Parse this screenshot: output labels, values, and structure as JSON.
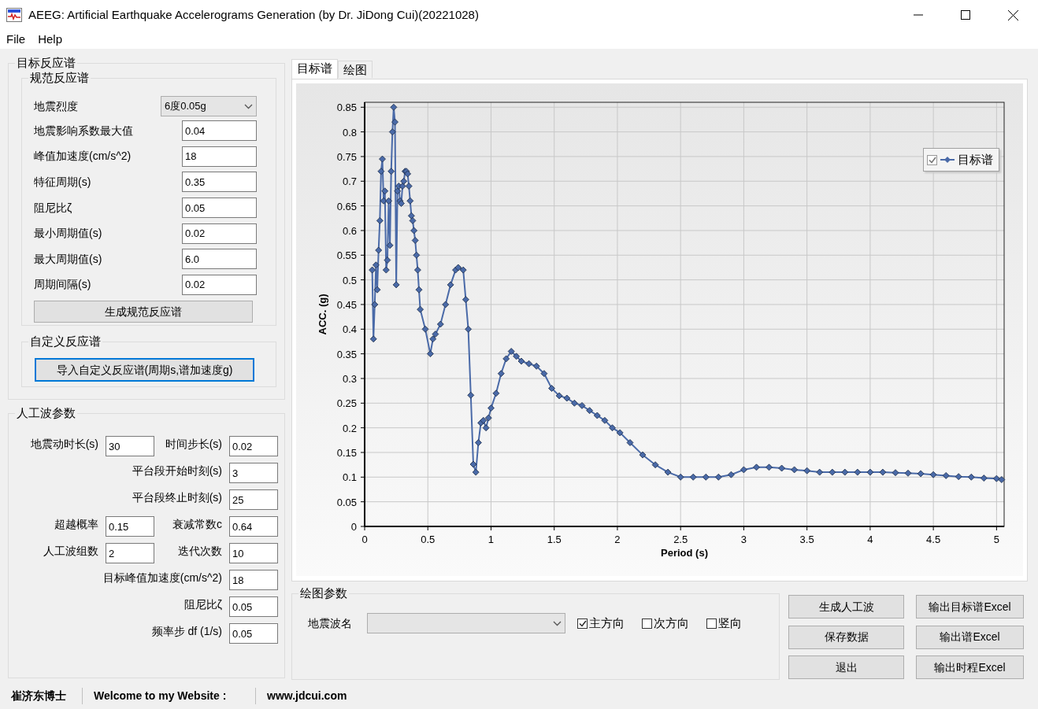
{
  "window": {
    "title": "AEEG: Artificial Earthquake Accelerograms Generation (by Dr. JiDong Cui)(20221028)"
  },
  "menu": [
    {
      "label": "File"
    },
    {
      "label": "Help"
    }
  ],
  "target_spectrum": {
    "title": "目标反应谱",
    "code_spectrum": {
      "title": "规范反应谱",
      "fields": [
        {
          "label": "地震烈度",
          "kind": "select",
          "value": "6度0.05g"
        },
        {
          "label": "地震影响系数最大值",
          "kind": "text",
          "value": "0.04"
        },
        {
          "label": "峰值加速度(cm/s^2)",
          "kind": "text",
          "value": "18"
        },
        {
          "label": "特征周期(s)",
          "kind": "text",
          "value": "0.35"
        },
        {
          "label": "阻尼比ζ",
          "kind": "text",
          "value": "0.05"
        },
        {
          "label": "最小周期值(s)",
          "kind": "text",
          "value": "0.02"
        },
        {
          "label": "最大周期值(s)",
          "kind": "text",
          "value": "6.0"
        },
        {
          "label": "周期间隔(s)",
          "kind": "text",
          "value": "0.02"
        }
      ],
      "button": {
        "label": "生成规范反应谱",
        "focused": false
      }
    },
    "custom_spectrum": {
      "title": "自定义反应谱",
      "button": {
        "label": "导入自定义反应谱(周期s,谱加速度g)",
        "focused": true
      }
    }
  },
  "wave_params": {
    "title": "人工波参数",
    "rows": [
      {
        "left": {
          "label": "地震动时长(s)",
          "value": "30"
        },
        "right": {
          "label": "时间步长(s)",
          "value": "0.02"
        }
      },
      {
        "right": {
          "label": "平台段开始时刻(s)",
          "value": "3"
        }
      },
      {
        "right": {
          "label": "平台段终止时刻(s)",
          "value": "25"
        }
      },
      {
        "left": {
          "label": "超越概率",
          "value": "0.15"
        },
        "right": {
          "label": "衰减常数c",
          "value": "0.64"
        }
      },
      {
        "left": {
          "label": "人工波组数",
          "value": "2"
        },
        "right": {
          "label": "迭代次数",
          "value": "10"
        }
      },
      {
        "right": {
          "label": "目标峰值加速度(cm/s^2)",
          "value": "18"
        }
      },
      {
        "right": {
          "label": "阻尼比ζ",
          "value": "0.05"
        }
      },
      {
        "right": {
          "label": "频率步 df (1/s)",
          "value": "0.05"
        }
      }
    ]
  },
  "tabs": [
    {
      "label": "目标谱",
      "selected": true
    },
    {
      "label": "绘图",
      "selected": false
    }
  ],
  "chart": {
    "legend_checked": true,
    "chart_data": {
      "type": "line",
      "grid": true,
      "xlabel": "Period (s)",
      "ylabel": "ACC. (g)",
      "xlim": [
        0,
        5.06
      ],
      "ylim": [
        0,
        0.86
      ],
      "xticks": [
        0,
        0.5,
        1,
        1.5,
        2,
        2.5,
        3,
        3.5,
        4,
        4.5,
        5
      ],
      "yticks": [
        0,
        0.05,
        0.1,
        0.15,
        0.2,
        0.25,
        0.3,
        0.35,
        0.4,
        0.45,
        0.5,
        0.55,
        0.6,
        0.65,
        0.7,
        0.75,
        0.8,
        0.85
      ],
      "x": [
        0.06,
        0.07,
        0.08,
        0.09,
        0.1,
        0.11,
        0.12,
        0.13,
        0.14,
        0.15,
        0.16,
        0.17,
        0.18,
        0.19,
        0.2,
        0.21,
        0.22,
        0.23,
        0.24,
        0.25,
        0.26,
        0.27,
        0.28,
        0.29,
        0.3,
        0.31,
        0.32,
        0.33,
        0.34,
        0.35,
        0.36,
        0.37,
        0.38,
        0.39,
        0.4,
        0.41,
        0.42,
        0.43,
        0.44,
        0.48,
        0.52,
        0.54,
        0.56,
        0.6,
        0.64,
        0.68,
        0.72,
        0.74,
        0.78,
        0.8,
        0.82,
        0.84,
        0.86,
        0.88,
        0.9,
        0.92,
        0.94,
        0.96,
        0.98,
        1,
        1.04,
        1.08,
        1.12,
        1.16,
        1.2,
        1.24,
        1.3,
        1.36,
        1.42,
        1.48,
        1.54,
        1.6,
        1.66,
        1.72,
        1.78,
        1.84,
        1.9,
        1.96,
        2.02,
        2.1,
        2.2,
        2.3,
        2.4,
        2.5,
        2.6,
        2.7,
        2.8,
        2.9,
        3,
        3.1,
        3.2,
        3.3,
        3.4,
        3.5,
        3.6,
        3.7,
        3.8,
        3.9,
        4,
        4.1,
        4.2,
        4.3,
        4.4,
        4.5,
        4.6,
        4.7,
        4.8,
        4.9,
        5,
        5.04
      ],
      "series": [
        {
          "name": "目标谱",
          "color": "#4a6aa8",
          "marker": "diamond",
          "values": [
            0.52,
            0.38,
            0.45,
            0.53,
            0.48,
            0.56,
            0.62,
            0.72,
            0.745,
            0.66,
            0.68,
            0.52,
            0.54,
            0.66,
            0.57,
            0.72,
            0.8,
            0.85,
            0.82,
            0.49,
            0.68,
            0.69,
            0.66,
            0.655,
            0.69,
            0.7,
            0.72,
            0.72,
            0.715,
            0.69,
            0.66,
            0.63,
            0.62,
            0.6,
            0.58,
            0.55,
            0.52,
            0.48,
            0.44,
            0.4,
            0.35,
            0.38,
            0.39,
            0.41,
            0.45,
            0.49,
            0.52,
            0.525,
            0.52,
            0.46,
            0.4,
            0.266,
            0.126,
            0.11,
            0.17,
            0.21,
            0.215,
            0.2,
            0.22,
            0.24,
            0.27,
            0.31,
            0.34,
            0.355,
            0.345,
            0.335,
            0.33,
            0.325,
            0.31,
            0.28,
            0.265,
            0.26,
            0.25,
            0.245,
            0.235,
            0.225,
            0.215,
            0.2,
            0.19,
            0.17,
            0.145,
            0.125,
            0.11,
            0.1,
            0.1,
            0.1,
            0.1,
            0.105,
            0.115,
            0.12,
            0.12,
            0.118,
            0.115,
            0.113,
            0.11,
            0.11,
            0.11,
            0.11,
            0.11,
            0.11,
            0.109,
            0.108,
            0.107,
            0.105,
            0.103,
            0.101,
            0.1,
            0.098,
            0.097,
            0.095
          ]
        }
      ]
    }
  },
  "plot_params": {
    "title": "绘图参数",
    "wave_label": "地震波名",
    "directions": [
      {
        "label": "主方向",
        "checked": true
      },
      {
        "label": "次方向",
        "checked": false
      },
      {
        "label": "竖向",
        "checked": false
      }
    ]
  },
  "actions": [
    {
      "label": "生成人工波"
    },
    {
      "label": "输出目标谱Excel"
    },
    {
      "label": "保存数据"
    },
    {
      "label": "输出谱Excel"
    },
    {
      "label": "退出"
    },
    {
      "label": "输出时程Excel"
    }
  ],
  "status_bar": [
    "崔济东博士",
    "Welcome to my Website :",
    "www.jdcui.com"
  ]
}
